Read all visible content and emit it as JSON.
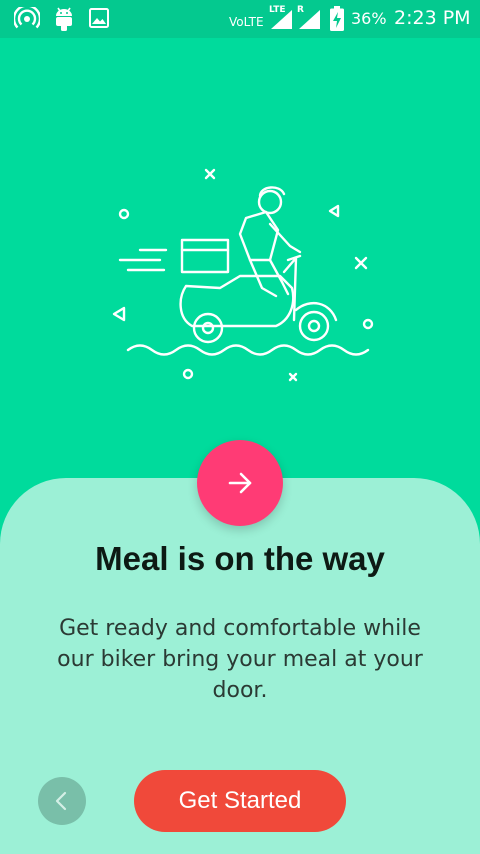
{
  "status_bar": {
    "volte_label": "VoLTE",
    "lte_label": "LTE",
    "roaming_label": "R",
    "battery_percent": "36%",
    "time": "2:23 PM",
    "icons": [
      "hotspot-icon",
      "android-icon",
      "image-icon",
      "signal-icon",
      "battery-charging-icon"
    ]
  },
  "onboarding": {
    "title": "Meal is on the way",
    "description": "Get ready and comfortable while our biker bring your meal at your door.",
    "next_icon": "arrow-right-icon",
    "back_icon": "chevron-left-icon",
    "cta_label": "Get Started"
  },
  "colors": {
    "background": "#00DB9C",
    "status_bar": "#04C98F",
    "card": "#9CF0D6",
    "fab": "#FF3B75",
    "cta": "#F0493A",
    "back_button": "#79BFA9"
  }
}
